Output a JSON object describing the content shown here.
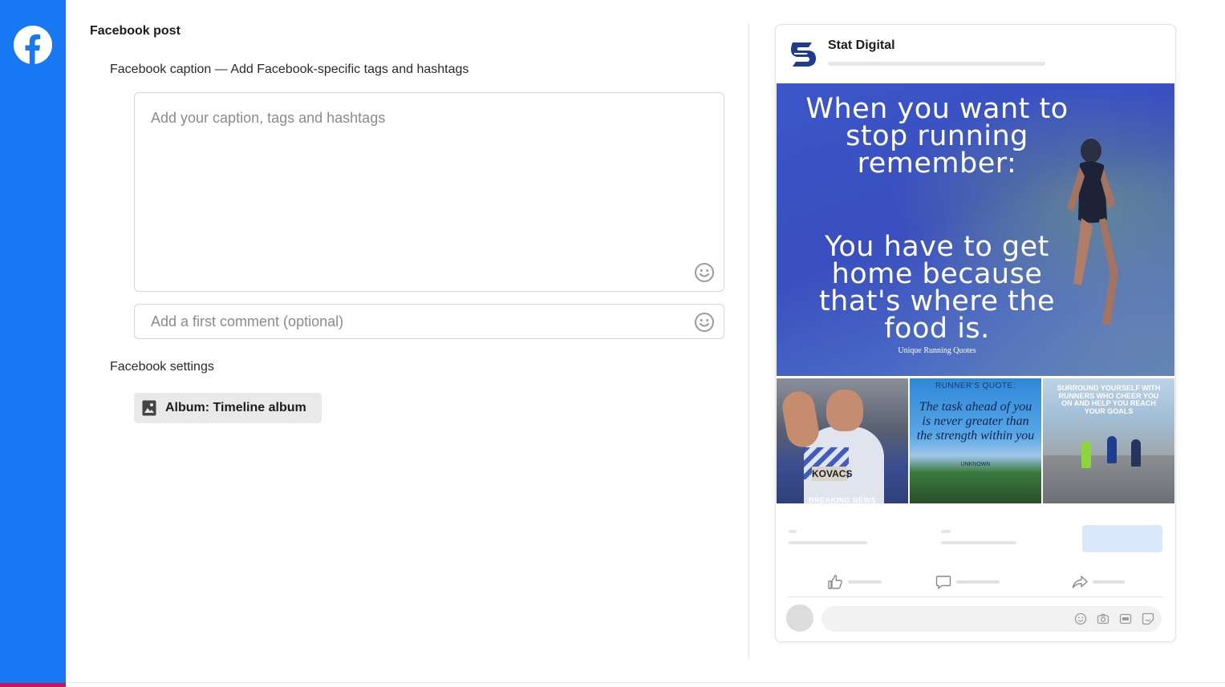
{
  "sidebar": {
    "network": "facebook",
    "logo_icon": "facebook-logo-icon",
    "accent": "#1877f2"
  },
  "editor": {
    "section_title": "Facebook post",
    "caption_label": "Facebook caption — Add Facebook-specific tags and hashtags",
    "caption_placeholder": "Add your caption, tags and hashtags",
    "caption_value": "",
    "comment_placeholder": "Add a first comment (optional)",
    "comment_value": "",
    "settings_label": "Facebook settings",
    "album_button_label": "Album: Timeline album"
  },
  "preview": {
    "page_name": "Stat Digital",
    "hero": {
      "quote_line_1": "When you want to stop running remember:",
      "quote_line_2": "You have to get home because that's where the food is.",
      "credit": "Unique Running Quotes"
    },
    "thumbs": {
      "thumb1_tag": "KOVACS",
      "thumb1_banner": "BREAKING NEWS",
      "thumb2_header": "RUNNER'S QUOTE:",
      "thumb2_quote": "The task ahead of you is never greater than the strength within you",
      "thumb2_footer": "UNKNOWN",
      "thumb3_header": "SURROUND YOURSELF WITH RUNNERS WHO CHEER YOU ON AND HELP YOU REACH YOUR GOALS"
    },
    "actions": [
      "like-icon",
      "comment-icon",
      "share-icon"
    ],
    "comment_icons": [
      "emoji-icon",
      "camera-icon",
      "gif-icon",
      "sticker-icon"
    ]
  }
}
